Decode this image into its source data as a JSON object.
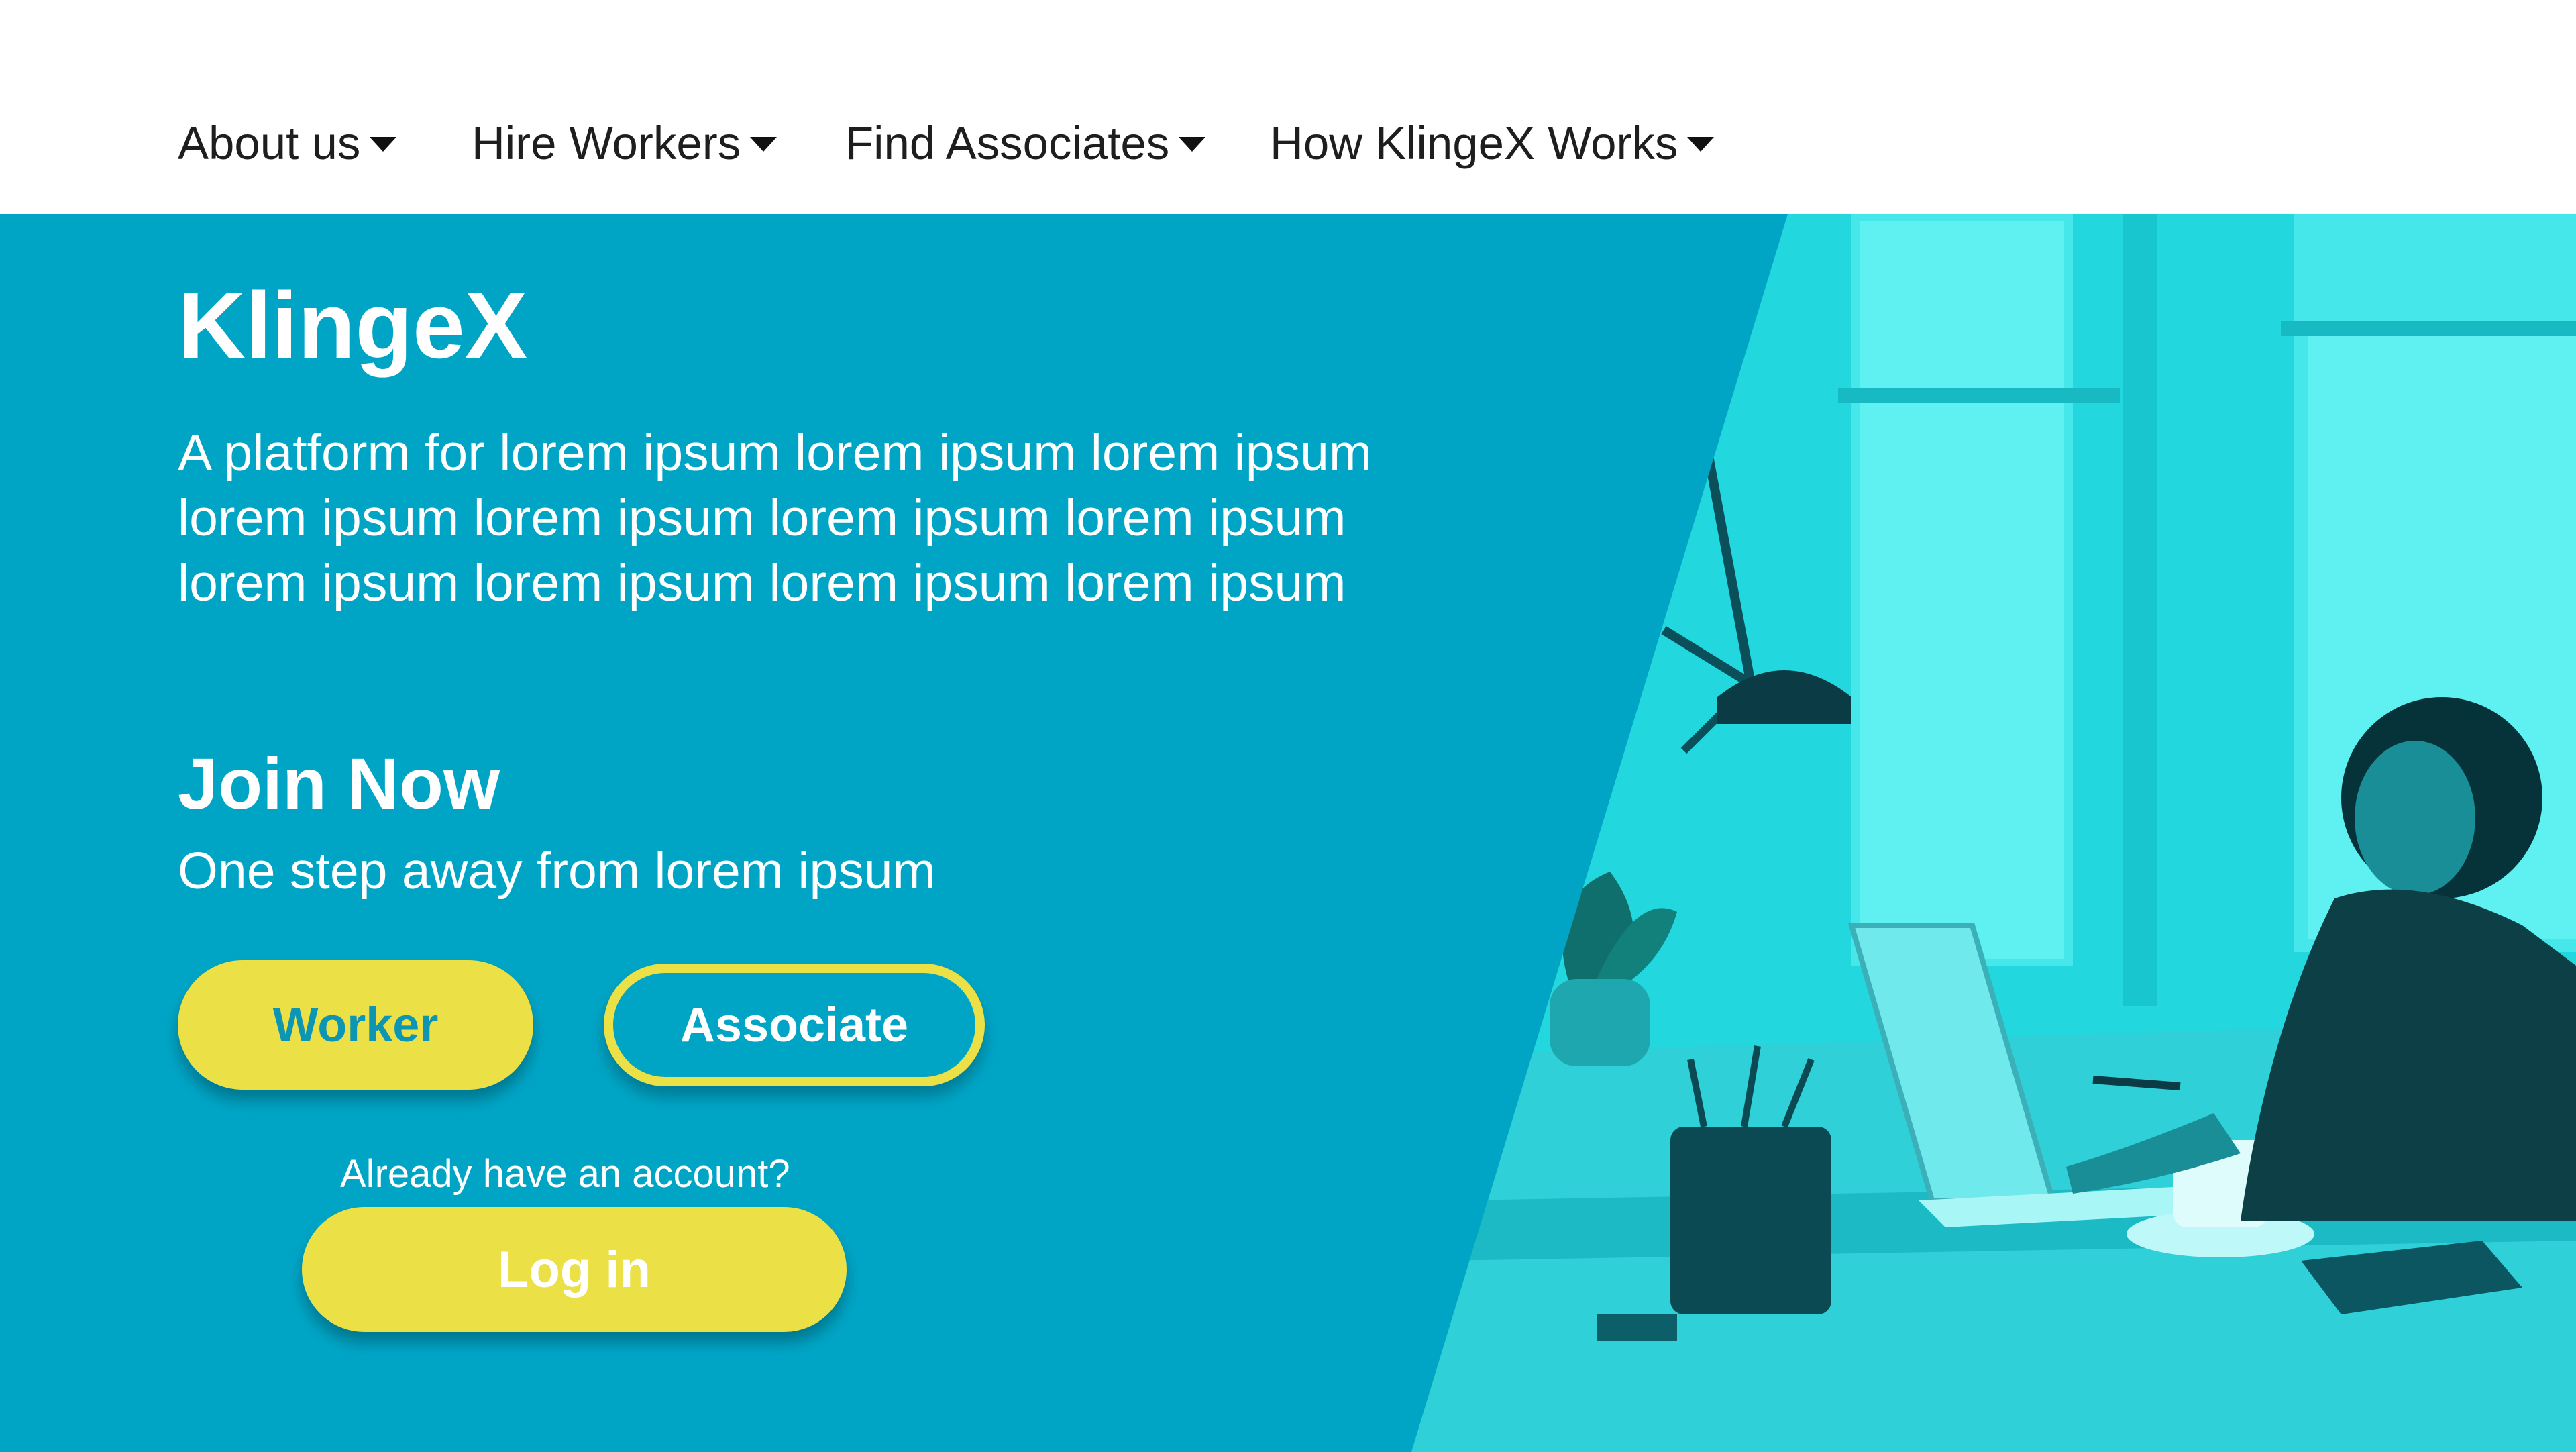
{
  "nav": {
    "items": [
      {
        "label": "About us"
      },
      {
        "label": "Hire Workers"
      },
      {
        "label": "Find Associates"
      },
      {
        "label": "How KlingeX Works"
      }
    ]
  },
  "hero": {
    "brand": "KlingeX",
    "tagline": "A platform for lorem ipsum lorem ipsum lorem ipsum lorem ipsum lorem ipsum lorem ipsum lorem ipsum lorem ipsum lorem ipsum lorem ipsum lorem ipsum",
    "join_title": "Join Now",
    "join_subtitle": "One step away from lorem ipsum",
    "worker_label": "Worker",
    "associate_label": "Associate",
    "account_question": "Already have an account?",
    "login_label": "Log in"
  },
  "colors": {
    "hero_background": "#00a5c6",
    "accent_yellow": "#ebe046",
    "photo_tint": "#22d7de",
    "nav_text": "#1e1e1e",
    "nav_background": "#ffffff"
  }
}
